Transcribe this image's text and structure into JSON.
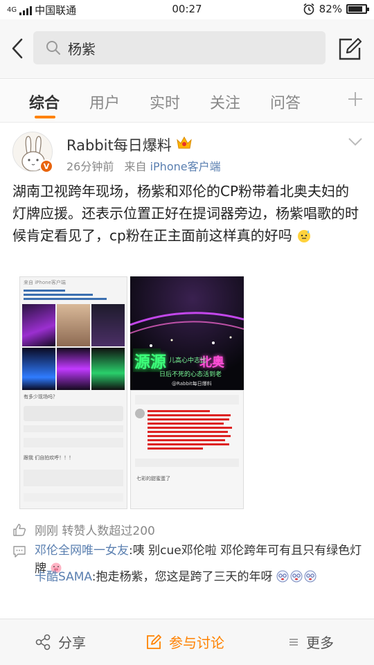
{
  "status_bar": {
    "network": "4G",
    "carrier": "中国联通",
    "time": "00:27",
    "battery": "82%",
    "battery_level": 0.82
  },
  "search": {
    "query": "杨紫"
  },
  "tabs": [
    {
      "label": "综合",
      "active": true
    },
    {
      "label": "用户",
      "active": false
    },
    {
      "label": "实时",
      "active": false
    },
    {
      "label": "关注",
      "active": false
    },
    {
      "label": "问答",
      "active": false
    }
  ],
  "post": {
    "user_name": "Rabbit每日爆料",
    "time": "26分钟前",
    "source_prefix": "来自",
    "source": "iPhone客户端",
    "text": "湖南卫视跨年现场，杨紫和邓伦的CP粉带着北奥夫妇的灯牌应援。还表示位置正好在提词器旁边，杨紫唱歌的时候肯定看见了，cp粉在正主面前这样真的好吗",
    "images": {
      "screenshot1_top": "来自 iPhone客户端",
      "screenshot1_mid": "有多少现场吗？",
      "screenshot1_bottom": "跟我 们自拍欢呼！！！",
      "stage_sign_1": "源源",
      "stage_sign_2": "北奥",
      "stage_caption_1": "儿高心中志比",
      "stage_caption_2": "日后不死的心态活到老",
      "watermark": "@Rabbit每日爆料",
      "screenshot2_comment": "七彩的甜蜜蛋了"
    }
  },
  "repost_stat": "刚刚 转赞人数超过200",
  "comments": [
    {
      "user": "邓伦全网唯一女友",
      "text": "咦 别cue邓伦啦 邓伦跨年可有且只有绿色灯牌"
    },
    {
      "user": "卡酷SAMA",
      "text": "抱走杨紫，您这是跨了三天的年呀"
    }
  ],
  "toolbar": {
    "share": "分享",
    "discuss": "参与讨论",
    "more": "更多"
  },
  "colors": {
    "accent": "#ff8200",
    "link": "#5a7fb0",
    "vip_badge": "#e8640d"
  }
}
